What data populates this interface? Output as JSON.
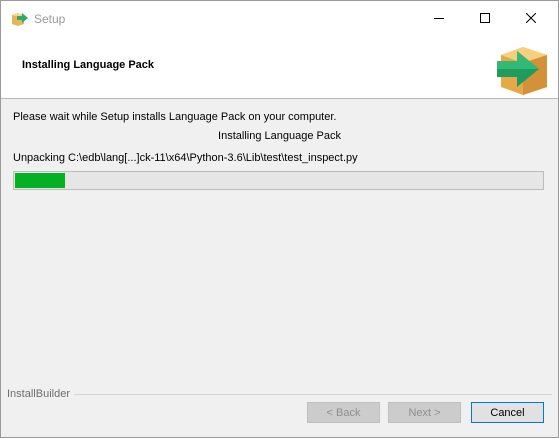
{
  "window": {
    "title": "Setup",
    "title_color": "#999999"
  },
  "header": {
    "title": "Installing Language Pack"
  },
  "content": {
    "wait_text": "Please wait while Setup installs Language Pack on your computer.",
    "progress_title": "Installing Language Pack",
    "unpack_text": "Unpacking C:\\edb\\lang[...]ck-11\\x64\\Python-3.6\\Lib\\test\\test_inspect.py",
    "progress_fraction": 0.094,
    "progress_color": "#06b025"
  },
  "footer": {
    "brand": "InstallBuilder",
    "back_label": "< Back",
    "next_label": "Next >",
    "cancel_label": "Cancel"
  },
  "icons": {
    "app": "package-arrow-icon",
    "header": "package-arrow-icon",
    "minimize": "minimize-icon",
    "maximize": "maximize-icon",
    "close": "close-icon"
  }
}
